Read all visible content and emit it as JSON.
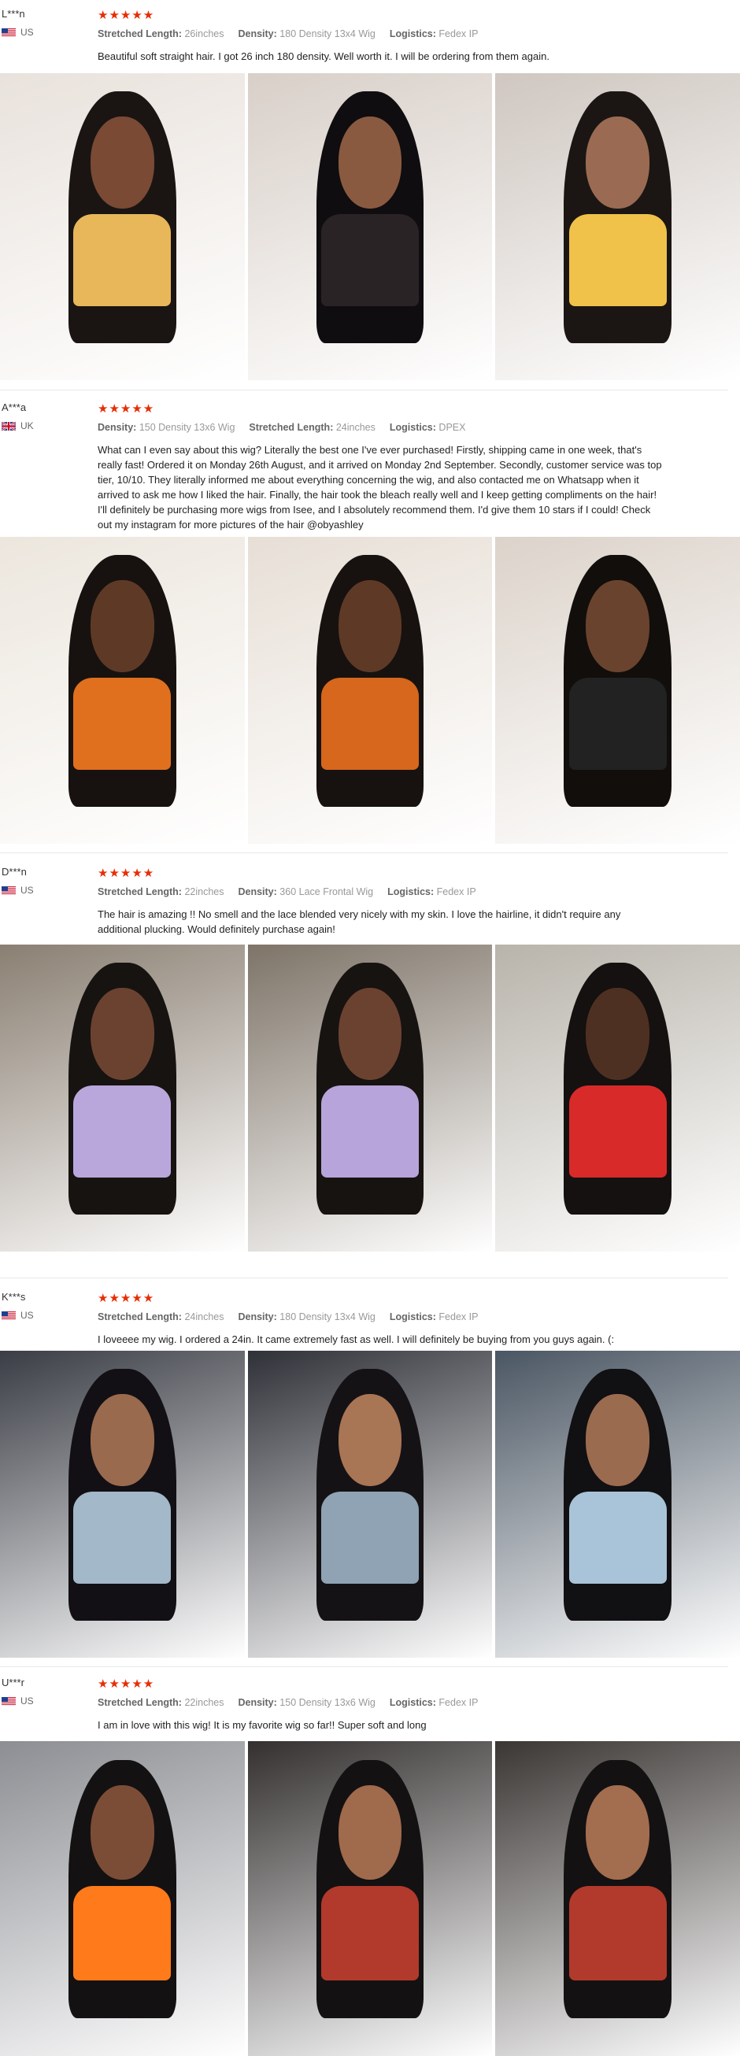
{
  "reviews": [
    {
      "name": "L***n",
      "country": "US",
      "stars": "★★★★★",
      "meta": [
        {
          "k": "Stretched Length:",
          "v": "26inches"
        },
        {
          "k": "Density:",
          "v": "180 Density 13x4 Wig"
        },
        {
          "k": "Logistics:",
          "v": "Fedex IP"
        }
      ],
      "text": "Beautiful soft straight hair. I got 26 inch 180 density. Well worth it. I will be ordering from them again.",
      "photos": [
        {
          "bg": "#e9e2dc",
          "hair": "#1a1513",
          "skin": "#7a4a34",
          "top": "#e8b75a"
        },
        {
          "bg": "#d8cfc8",
          "hair": "#0f0d10",
          "skin": "#8a5a40",
          "top": "#2a2326"
        },
        {
          "bg": "#cfc7c0",
          "hair": "#1b1614",
          "skin": "#9a6b52",
          "top": "#f0c24a"
        }
      ]
    },
    {
      "name": "A***a",
      "country": "UK",
      "stars": "★★★★★",
      "meta": [
        {
          "k": "Density:",
          "v": "150 Density 13x6 Wig"
        },
        {
          "k": "Stretched Length:",
          "v": "24inches"
        },
        {
          "k": "Logistics:",
          "v": "DPEX"
        }
      ],
      "text": "What can I even say about this wig? Literally the best one I've ever purchased! Firstly, shipping came in one week, that's really fast! Ordered it on Monday 26th August, and it arrived on Monday 2nd September. Secondly, customer service was top tier, 10/10. They literally informed me about everything concerning the wig, and also contacted me on Whatsapp when it arrived to ask me how I liked the hair. Finally, the hair took the bleach really well and I keep getting compliments on the hair! I'll definitely be purchasing more wigs from Isee, and I absolutely recommend them. I'd give them 10 stars if I could! Check out my instagram for more pictures of the hair @obyashley",
      "photos": [
        {
          "bg": "#ece6dd",
          "hair": "#17120f",
          "skin": "#5e3a26",
          "top": "#e0701e"
        },
        {
          "bg": "#e7dfd6",
          "hair": "#17120f",
          "skin": "#5e3a26",
          "top": "#d6671c"
        },
        {
          "bg": "#dcd3ca",
          "hair": "#120e0c",
          "skin": "#6a432e",
          "top": "#222222"
        }
      ]
    },
    {
      "name": "D***n",
      "country": "US",
      "stars": "★★★★★",
      "meta": [
        {
          "k": "Stretched Length:",
          "v": "22inches"
        },
        {
          "k": "Density:",
          "v": "360 Lace Frontal Wig"
        },
        {
          "k": "Logistics:",
          "v": "Fedex IP"
        }
      ],
      "text": "The hair is amazing !! No smell and the lace blended very nicely with my skin. I love the hairline, it didn't require any additional plucking. Would definitely purchase again!",
      "photos": [
        {
          "bg": "#8a7f72",
          "hair": "#171311",
          "skin": "#6b4230",
          "top": "#b9a7dc"
        },
        {
          "bg": "#7e7468",
          "hair": "#171311",
          "skin": "#6b4230",
          "top": "#b7a4da"
        },
        {
          "bg": "#b8b4ab",
          "hair": "#141110",
          "skin": "#4e3022",
          "top": "#d92a2a"
        }
      ]
    },
    {
      "name": "K***s",
      "country": "US",
      "stars": "★★★★★",
      "meta": [
        {
          "k": "Stretched Length:",
          "v": "24inches"
        },
        {
          "k": "Density:",
          "v": "180 Density 13x4 Wig"
        },
        {
          "k": "Logistics:",
          "v": "Fedex IP"
        }
      ],
      "text": "I loveeee my wig. I ordered a 24in. It came extremely fast as well. I will definitely be buying from you guys again. (:",
      "photos": [
        {
          "bg": "#3a3d45",
          "hair": "#121014",
          "skin": "#9a6a4e",
          "top": "#a3b8c9"
        },
        {
          "bg": "#2f3138",
          "hair": "#151215",
          "skin": "#a87555",
          "top": "#8fa3b4"
        },
        {
          "bg": "#4a5663",
          "hair": "#111013",
          "skin": "#9b6b50",
          "top": "#a9c4d8"
        }
      ]
    },
    {
      "name": "U***r",
      "country": "US",
      "stars": "★★★★★",
      "meta": [
        {
          "k": "Stretched Length:",
          "v": "22inches"
        },
        {
          "k": "Density:",
          "v": "150 Density 13x6 Wig"
        },
        {
          "k": "Logistics:",
          "v": "Fedex IP"
        }
      ],
      "text": "I am in love with this wig! It is my favorite wig so far!! Super soft and long",
      "photos": [
        {
          "bg": "#8c8e93",
          "hair": "#141112",
          "skin": "#7c4d36",
          "top": "#ff7a1a"
        },
        {
          "bg": "#33302f",
          "hair": "#141112",
          "skin": "#a06a4c",
          "top": "#b23a2c"
        },
        {
          "bg": "#3a3634",
          "hair": "#141112",
          "skin": "#a36d4f",
          "top": "#b23a2c"
        }
      ]
    }
  ]
}
